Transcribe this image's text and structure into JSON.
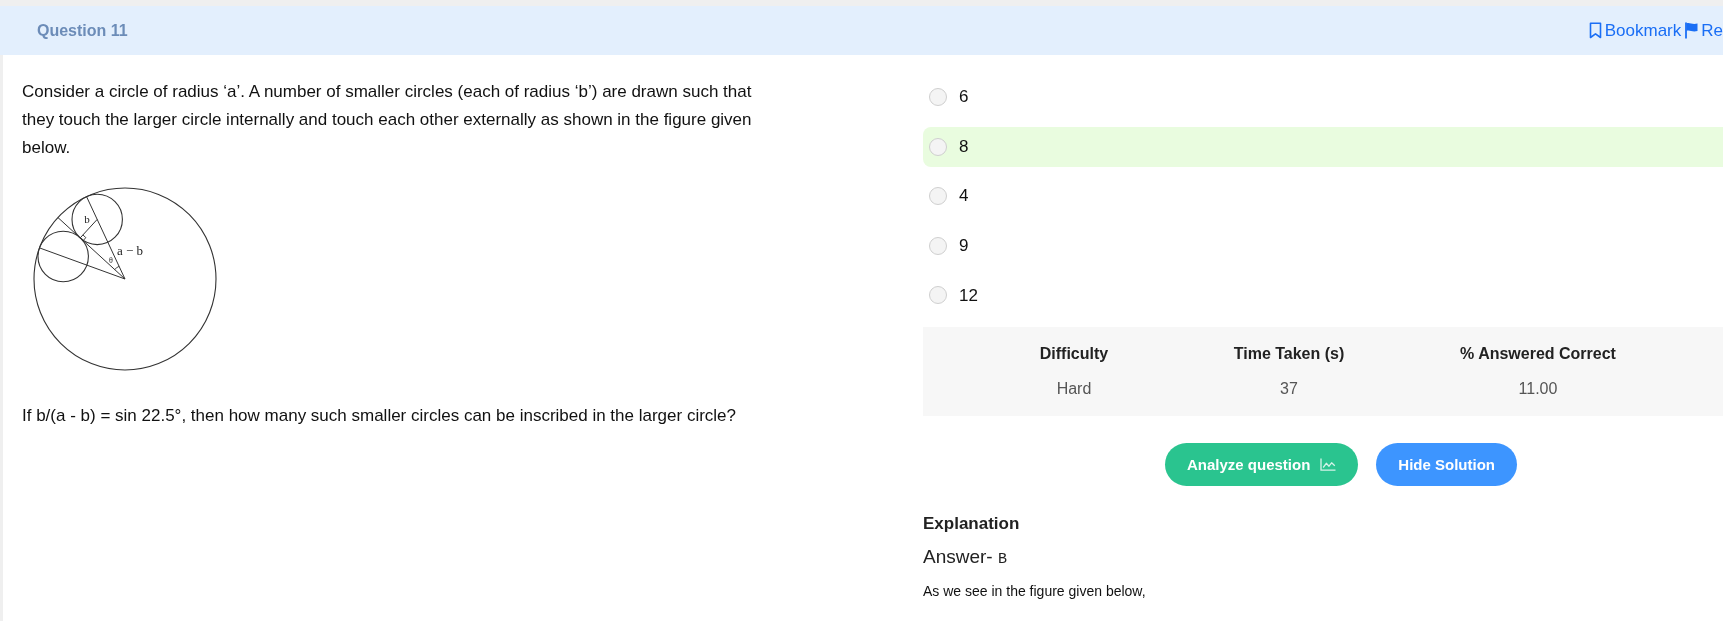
{
  "header": {
    "title": "Question 11",
    "actions": [
      {
        "label": "Bookmark",
        "kind": "bookmark"
      },
      {
        "label": "Re",
        "kind": "flag"
      }
    ]
  },
  "question": {
    "text": "Consider a circle of radius ‘a’. A number of smaller circles (each of radius ‘b’) are drawn such that they touch the larger circle internally and touch each other externally as shown in the figure given below.",
    "figure": {
      "labels": [
        {
          "kind": "radius",
          "text": "b"
        },
        {
          "kind": "angle",
          "text": "θ"
        },
        {
          "kind": "distance",
          "text": "a − b"
        }
      ]
    },
    "prompt": "If b/(a - b) = sin 22.5°, then how many such smaller circles can be inscribed in the larger circle?"
  },
  "options": [
    {
      "label": "6",
      "selected": false,
      "correct": false
    },
    {
      "label": "8",
      "selected": false,
      "correct": true
    },
    {
      "label": "4",
      "selected": false,
      "correct": false
    },
    {
      "label": "9",
      "selected": false,
      "correct": false
    },
    {
      "label": "12",
      "selected": false,
      "correct": false
    }
  ],
  "stats": [
    {
      "header": "Difficulty",
      "value": "Hard"
    },
    {
      "header": "Time Taken (s)",
      "value": "37"
    },
    {
      "header": "% Answered Correct",
      "value": "11.00"
    }
  ],
  "buttons": [
    {
      "label": "Analyze question",
      "kind": "analyze"
    },
    {
      "label": "Hide Solution",
      "kind": "toggle"
    }
  ],
  "explanation": {
    "heading": "Explanation",
    "answer_label": "Answer-",
    "answer_value": "B",
    "text": "As we see in the figure given below,"
  }
}
